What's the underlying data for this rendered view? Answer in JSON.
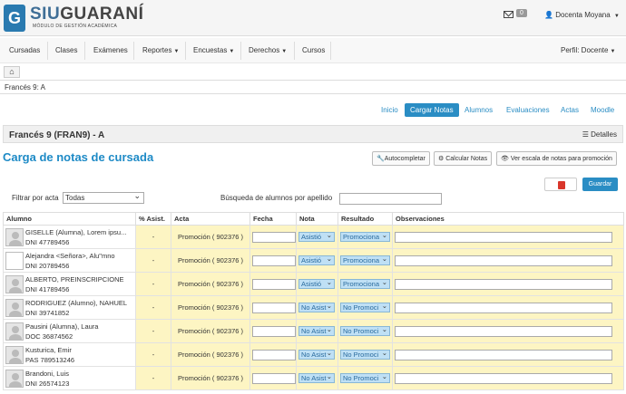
{
  "header": {
    "logo_letter": "G",
    "logo_title_a": "SIU",
    "logo_title_b": "GUARANÍ",
    "logo_subtitle": "MÓDULO DE GESTIÓN ACADÉMICA",
    "mail_count": "0",
    "user": "Docenta Moyana"
  },
  "nav": {
    "items": [
      "Cursadas",
      "Clases",
      "Exámenes",
      "Reportes",
      "Encuestas",
      "Derechos",
      "Cursos"
    ],
    "perfil": "Perfil: Docente"
  },
  "breadcrumb": "Francés 9: A",
  "tabs": [
    "Inicio",
    "Cargar Notas",
    "Alumnos",
    "Evaluaciones",
    "Actas",
    "Moodle"
  ],
  "panel": {
    "title": "Francés 9 (FRAN9) - A",
    "details": "Detalles"
  },
  "page_title": "Carga de notas de cursada",
  "toolbar": {
    "autocompletar": "Autocompletar",
    "calcular": "Calcular Notas",
    "escala": "Ver escala de notas para promoción",
    "guardar": "Guardar"
  },
  "filter": {
    "label": "Filtrar por acta",
    "value": "Todas"
  },
  "search": {
    "label": "Búsqueda de alumnos por apellido",
    "value": ""
  },
  "table": {
    "headers": [
      "Alumno",
      "% Asist.",
      "Acta",
      "Fecha",
      "Nota",
      "Resultado",
      "Observaciones"
    ],
    "rows": [
      {
        "name": "GISELLE (Alumna), Lorem ipsu...",
        "doc": "DNI 47789456",
        "asist": "-",
        "acta": "Promoción ( 902376 )",
        "nota": "Asistió",
        "resultado": "Promociona"
      },
      {
        "name": "Alejandra <Señora>, Alu\"mno",
        "doc": "DNI 20789456",
        "asist": "-",
        "acta": "Promoción ( 902376 )",
        "nota": "Asistió",
        "resultado": "Promociona"
      },
      {
        "name": "ALBERTO, PREINSCRIPCIONE",
        "doc": "DNI 41789456",
        "asist": "-",
        "acta": "Promoción ( 902376 )",
        "nota": "Asistió",
        "resultado": "Promociona"
      },
      {
        "name": "RODRIGUEZ (Alumno), NAHUEL",
        "doc": "DNI 39741852",
        "asist": "-",
        "acta": "Promoción ( 902376 )",
        "nota": "No Asist",
        "resultado": "No Promoci"
      },
      {
        "name": "Pausini (Alumna), Laura",
        "doc": "DOC 36874562",
        "asist": "-",
        "acta": "Promoción ( 902376 )",
        "nota": "No Asist",
        "resultado": "No Promoci"
      },
      {
        "name": "Kusturica, Emir",
        "doc": "PAS 789513246",
        "asist": "-",
        "acta": "Promoción ( 902376 )",
        "nota": "No Asist",
        "resultado": "No Promoci"
      },
      {
        "name": "Brandoni, Luis",
        "doc": "DNI 26574123",
        "asist": "-",
        "acta": "Promoción ( 902376 )",
        "nota": "No Asist",
        "resultado": "No Promoci"
      }
    ]
  }
}
